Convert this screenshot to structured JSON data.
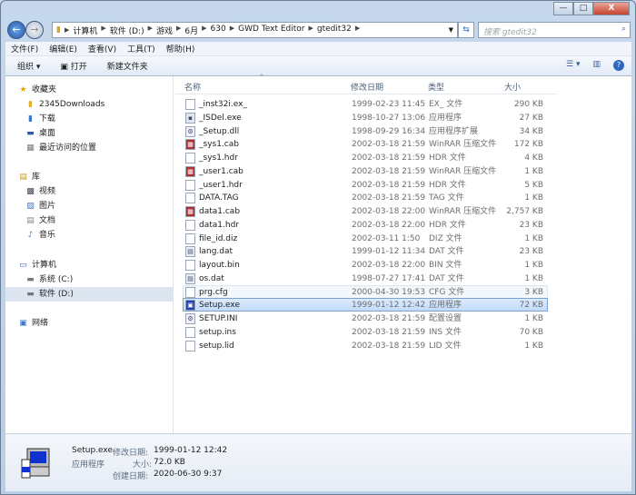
{
  "window": {
    "minimize": "—",
    "maximize": "□",
    "close": "X"
  },
  "address": {
    "crumbs": [
      "计算机",
      "软件 (D:)",
      "游戏",
      "6月",
      "630",
      "GWD Text Editor",
      "gtedit32"
    ],
    "search_placeholder": "搜索 gtedit32"
  },
  "menu": [
    "文件(F)",
    "编辑(E)",
    "查看(V)",
    "工具(T)",
    "帮助(H)"
  ],
  "toolbar": {
    "organize": "组织 ▾",
    "open": "打开",
    "new_folder": "新建文件夹"
  },
  "nav": {
    "favorites": "收藏夹",
    "fav_items": [
      "2345Downloads",
      "下载",
      "桌面",
      "最近访问的位置"
    ],
    "libraries": "库",
    "lib_items": [
      "视频",
      "图片",
      "文档",
      "音乐"
    ],
    "computer": "计算机",
    "drives": [
      "系统 (C:)",
      "软件 (D:)"
    ],
    "network": "网络"
  },
  "columns": {
    "name": "名称",
    "date": "修改日期",
    "type": "类型",
    "size": "大小"
  },
  "files": [
    {
      "name": "_inst32i.ex_",
      "date": "1999-02-23 11:45",
      "type": "EX_ 文件",
      "size": "290 KB",
      "icon": "file"
    },
    {
      "name": "_ISDel.exe",
      "date": "1998-10-27 13:06",
      "type": "应用程序",
      "size": "27 KB",
      "icon": "exe"
    },
    {
      "name": "_Setup.dll",
      "date": "1998-09-29 16:34",
      "type": "应用程序扩展",
      "size": "34 KB",
      "icon": "dll"
    },
    {
      "name": "_sys1.cab",
      "date": "2002-03-18 21:59",
      "type": "WinRAR 压缩文件",
      "size": "172 KB",
      "icon": "rar"
    },
    {
      "name": "_sys1.hdr",
      "date": "2002-03-18 21:59",
      "type": "HDR 文件",
      "size": "4 KB",
      "icon": "file"
    },
    {
      "name": "_user1.cab",
      "date": "2002-03-18 21:59",
      "type": "WinRAR 压缩文件",
      "size": "1 KB",
      "icon": "rar"
    },
    {
      "name": "_user1.hdr",
      "date": "2002-03-18 21:59",
      "type": "HDR 文件",
      "size": "5 KB",
      "icon": "file"
    },
    {
      "name": "DATA.TAG",
      "date": "2002-03-18 21:59",
      "type": "TAG 文件",
      "size": "1 KB",
      "icon": "file"
    },
    {
      "name": "data1.cab",
      "date": "2002-03-18 22:00",
      "type": "WinRAR 压缩文件",
      "size": "2,757 KB",
      "icon": "rar"
    },
    {
      "name": "data1.hdr",
      "date": "2002-03-18 22:00",
      "type": "HDR 文件",
      "size": "23 KB",
      "icon": "file"
    },
    {
      "name": "file_id.diz",
      "date": "2002-03-11 1:50",
      "type": "DIZ 文件",
      "size": "1 KB",
      "icon": "file"
    },
    {
      "name": "lang.dat",
      "date": "1999-01-12 11:34",
      "type": "DAT 文件",
      "size": "23 KB",
      "icon": "dat"
    },
    {
      "name": "layout.bin",
      "date": "2002-03-18 22:00",
      "type": "BIN 文件",
      "size": "1 KB",
      "icon": "file"
    },
    {
      "name": "os.dat",
      "date": "1998-07-27 17:41",
      "type": "DAT 文件",
      "size": "1 KB",
      "icon": "dat"
    },
    {
      "name": "prg.cfg",
      "date": "2000-04-30 19:53",
      "type": "CFG 文件",
      "size": "3 KB",
      "icon": "file"
    },
    {
      "name": "Setup.exe",
      "date": "1999-01-12 12:42",
      "type": "应用程序",
      "size": "72 KB",
      "icon": "setup"
    },
    {
      "name": "SETUP.INI",
      "date": "2002-03-18 21:59",
      "type": "配置设置",
      "size": "1 KB",
      "icon": "ini"
    },
    {
      "name": "setup.ins",
      "date": "2002-03-18 21:59",
      "type": "INS 文件",
      "size": "70 KB",
      "icon": "file"
    },
    {
      "name": "setup.lid",
      "date": "2002-03-18 21:59",
      "type": "LID 文件",
      "size": "1 KB",
      "icon": "file"
    }
  ],
  "details": {
    "name": "Setup.exe",
    "type": "应用程序",
    "modified_label": "修改日期:",
    "modified": "1999-01-12 12:42",
    "size_label": "大小:",
    "size": "72.0 KB",
    "created_label": "创建日期:",
    "created": "2020-06-30 9:37"
  }
}
